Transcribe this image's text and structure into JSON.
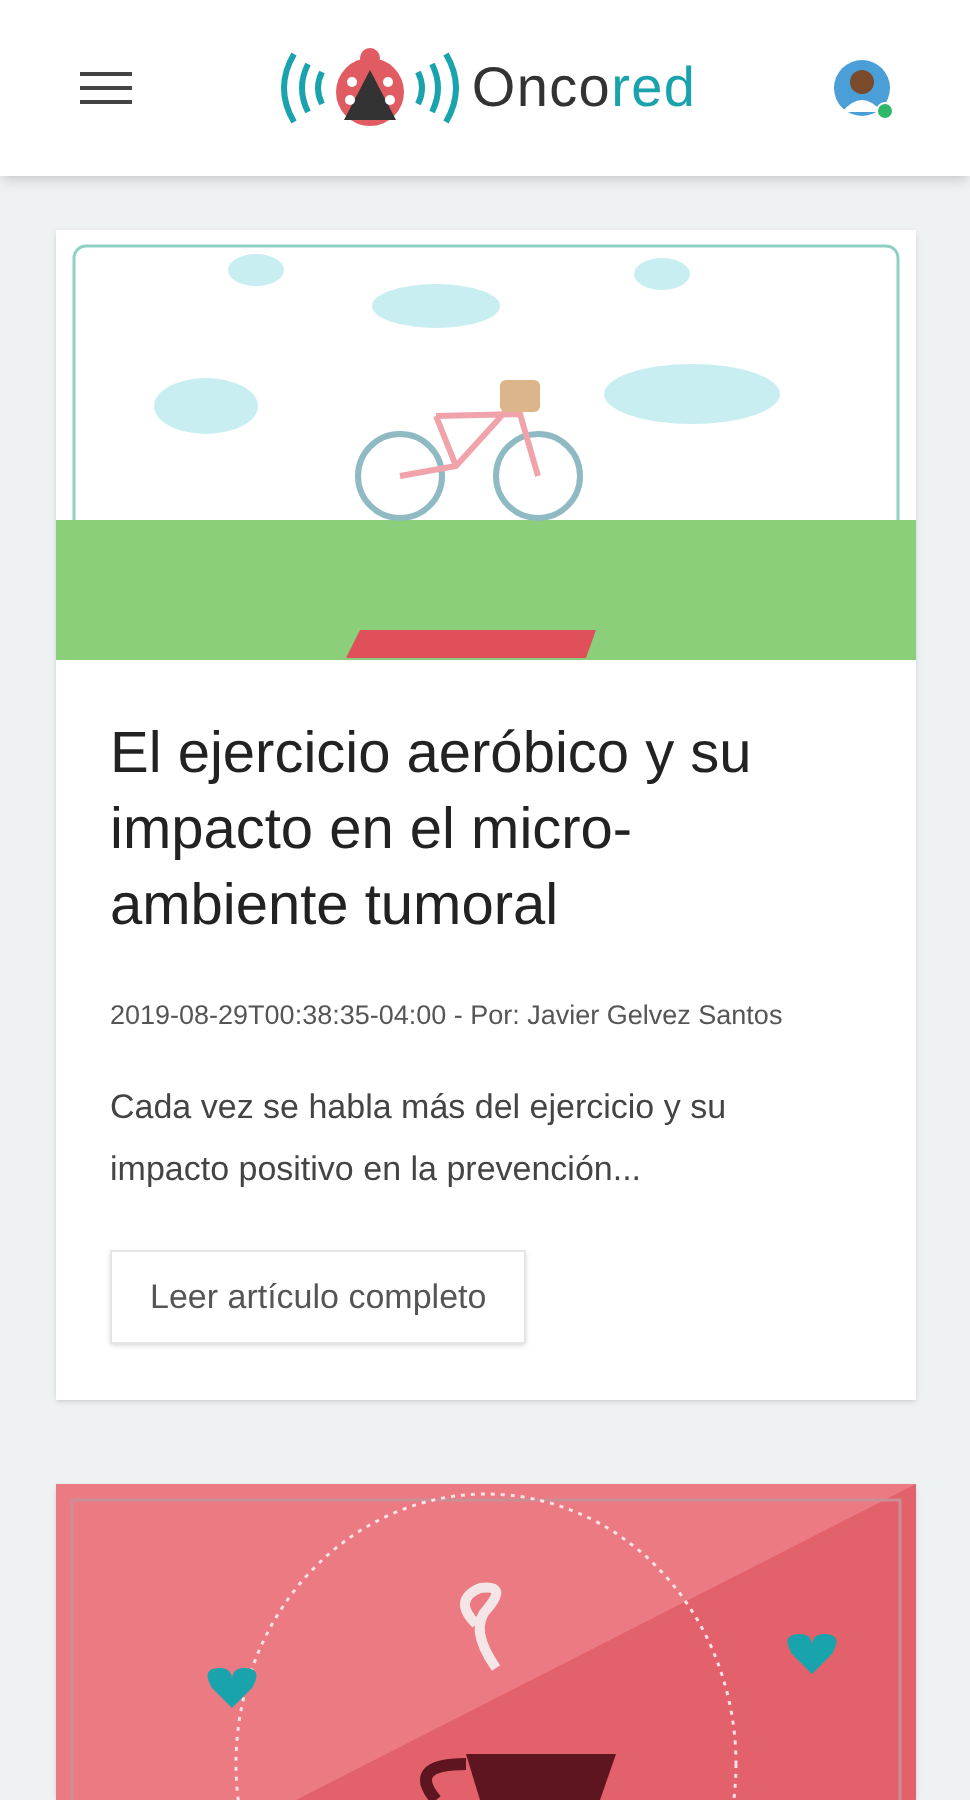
{
  "header": {
    "logo": {
      "dark": "Onco",
      "accent": "red"
    }
  },
  "articles": [
    {
      "kind": "picture",
      "title": "El ejercicio aeróbico y su impacto en el micro-ambiente tumoral",
      "meta": "2019-08-29T00:38:35-04:00 - Por: Javier Gelvez Santos",
      "excerpt": "Cada vez se habla más del ejercicio y su impacto positivo en la prevención...",
      "button": "Leer artículo completo"
    },
    {
      "kind": "picture"
    }
  ]
}
